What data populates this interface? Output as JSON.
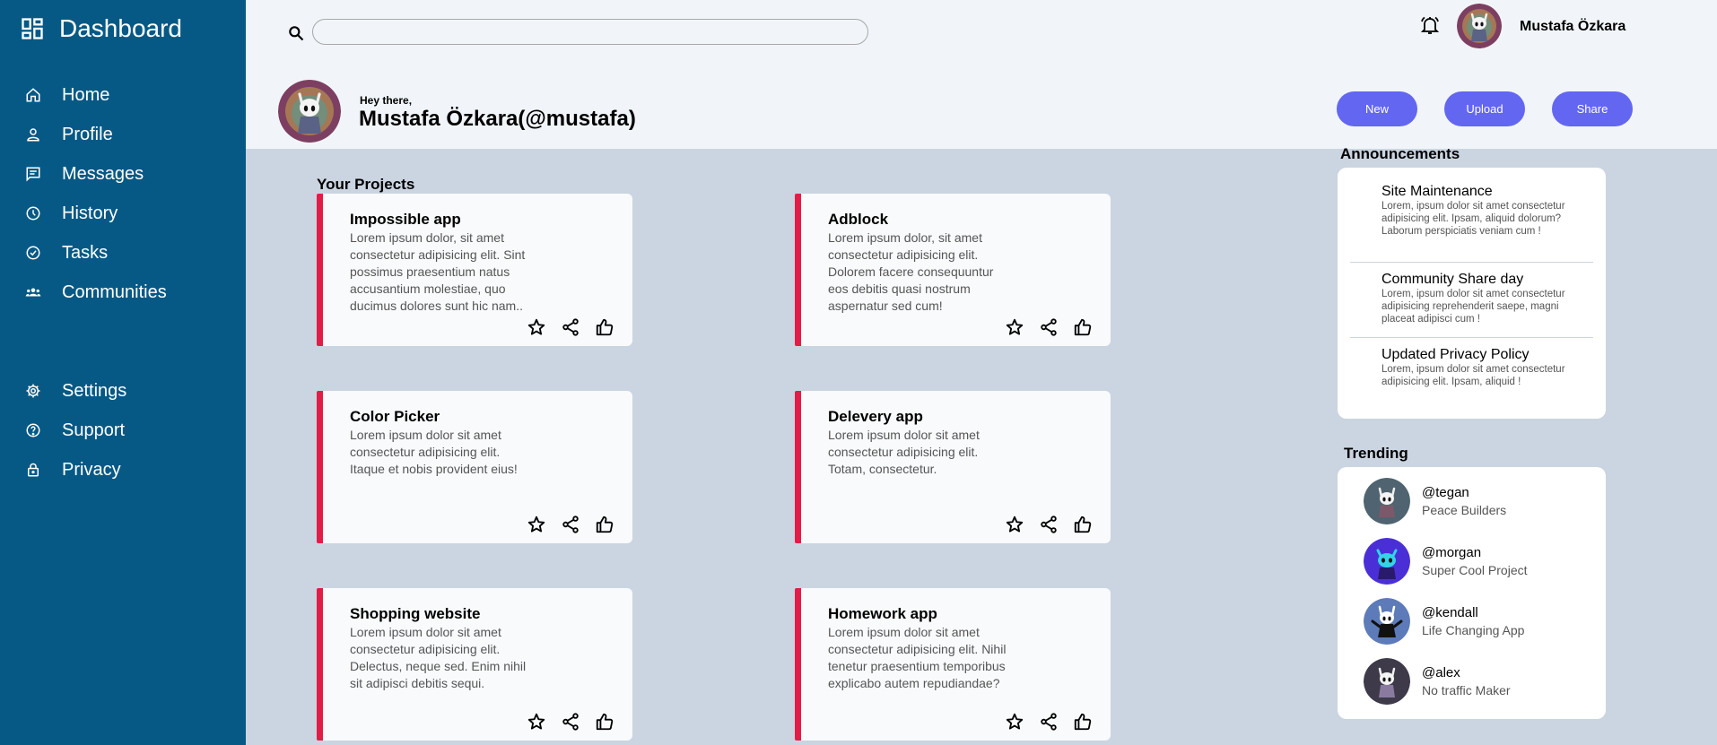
{
  "sidebar": {
    "brand": "Dashboard",
    "items": [
      {
        "label": "Home",
        "icon": "home-icon"
      },
      {
        "label": "Profile",
        "icon": "profile-icon"
      },
      {
        "label": "Messages",
        "icon": "messages-icon"
      },
      {
        "label": "History",
        "icon": "history-icon"
      },
      {
        "label": "Tasks",
        "icon": "tasks-icon"
      },
      {
        "label": "Communities",
        "icon": "communities-icon"
      }
    ],
    "secondary_items": [
      {
        "label": "Settings",
        "icon": "gear-icon"
      },
      {
        "label": "Support",
        "icon": "help-icon"
      },
      {
        "label": "Privacy",
        "icon": "lock-icon"
      }
    ]
  },
  "header": {
    "search": {
      "value": "",
      "placeholder": ""
    },
    "user_name": "Mustafa Özkara",
    "greeting": "Hey there,",
    "handle": "Mustafa Özkara(@mustafa)",
    "buttons": {
      "new": "New",
      "upload": "Upload",
      "share": "Share"
    }
  },
  "projects": {
    "title": "Your Projects",
    "cards": [
      {
        "title": "Impossible app",
        "desc": "Lorem ipsum dolor, sit amet consectetur adipisicing elit. Sint possimus praesentium natus accusantium molestiae, quo ducimus dolores sunt hic nam.."
      },
      {
        "title": "Adblock",
        "desc": "Lorem ipsum dolor, sit amet consectetur adipisicing elit. Dolorem facere consequuntur eos debitis quasi nostrum aspernatur sed cum!"
      },
      {
        "title": "Color Picker",
        "desc": "Lorem ipsum dolor sit amet consectetur adipisicing elit. Itaque et nobis provident eius!"
      },
      {
        "title": "Delevery app",
        "desc": "Lorem ipsum dolor sit amet consectetur adipisicing elit. Totam, consectetur."
      },
      {
        "title": "Shopping website",
        "desc": "Lorem ipsum dolor sit amet consectetur adipisicing elit. Delectus, neque sed. Enim nihil sit adipisci debitis sequi."
      },
      {
        "title": "Homework app",
        "desc": "Lorem ipsum dolor sit amet consectetur adipisicing elit. Nihil tenetur praesentium temporibus explicabo autem repudiandae?"
      }
    ]
  },
  "announcements": {
    "title": "Announcements",
    "items": [
      {
        "title": "Site Maintenance",
        "desc": "Lorem, ipsum dolor sit amet consectetur adipisicing elit. Ipsam, aliquid dolorum? Laborum perspiciatis veniam cum !"
      },
      {
        "title": "Community Share day",
        "desc": "Lorem, ipsum dolor sit amet consectetur adipisicing reprehenderit saepe, magni placeat adipisci cum !"
      },
      {
        "title": "Updated Privacy Policy",
        "desc": "Lorem, ipsum dolor sit amet consectetur adipisicing elit. Ipsam, aliquid !"
      }
    ]
  },
  "trending": {
    "title": "Trending",
    "items": [
      {
        "handle": "@tegan",
        "project": "Peace Builders"
      },
      {
        "handle": "@morgan",
        "project": "Super Cool Project"
      },
      {
        "handle": "@kendall",
        "project": "Life Changing App"
      },
      {
        "handle": "@alex",
        "project": "No traffic Maker"
      }
    ]
  },
  "colors": {
    "sidebar": "#075985",
    "accent_button": "#6366f1",
    "card_border": "#e11d48",
    "content_bg": "#cbd5e1",
    "header_bg": "#f1f5f9"
  }
}
